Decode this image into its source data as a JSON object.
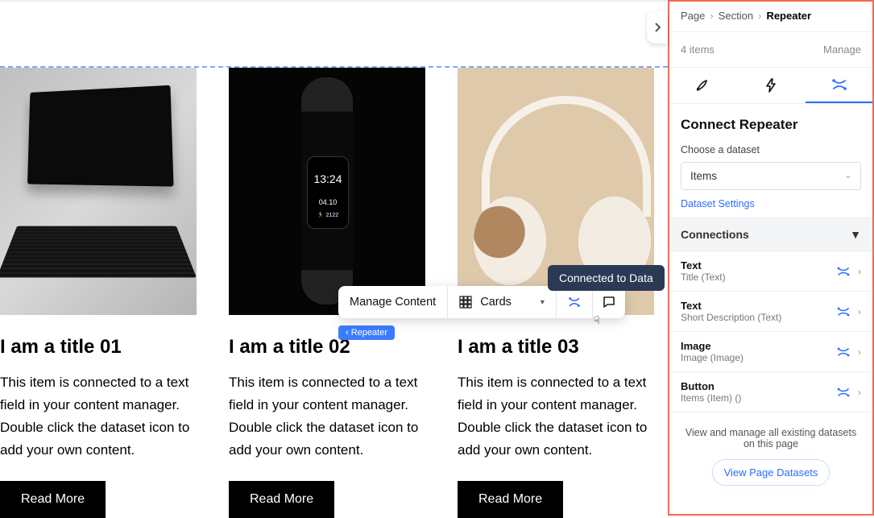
{
  "canvas": {
    "cards": [
      {
        "title": "I am a title 01",
        "desc": "This item is connected to a text field in your content manager. Double click the dataset icon to add your own content.",
        "button": "Read More",
        "watch": {}
      },
      {
        "title": "I am a title 02",
        "desc": "This item is connected to a text field in your content manager. Double click the dataset icon to add your own content.",
        "button": "Read More",
        "watch": {
          "time": "13:24",
          "date": "04.10",
          "steps": "🏃 2122"
        }
      },
      {
        "title": "I am a title 03",
        "desc": "This item is connected to a text field in your content manager. Double click the dataset icon to add your own content.",
        "button": "Read More",
        "watch": {}
      }
    ],
    "toolbar": {
      "manage_content": "Manage Content",
      "layout_label": "Cards"
    },
    "tooltip": "Connected to Data",
    "repeater_badge": "Repeater"
  },
  "panel": {
    "breadcrumb": [
      "Page",
      "Section",
      "Repeater"
    ],
    "item_count": "4 items",
    "manage_label": "Manage",
    "section_title": "Connect Repeater",
    "choose_label": "Choose a dataset",
    "dataset_value": "Items",
    "dataset_settings": "Dataset Settings",
    "connections_header": "Connections",
    "connections": [
      {
        "title": "Text",
        "sub": "Title (Text)"
      },
      {
        "title": "Text",
        "sub": "Short Description (Text)"
      },
      {
        "title": "Image",
        "sub": "Image (Image)"
      },
      {
        "title": "Button",
        "sub": "Items (Item) ()"
      }
    ],
    "footer_text": "View and manage all existing datasets on this page",
    "footer_button": "View Page Datasets"
  }
}
